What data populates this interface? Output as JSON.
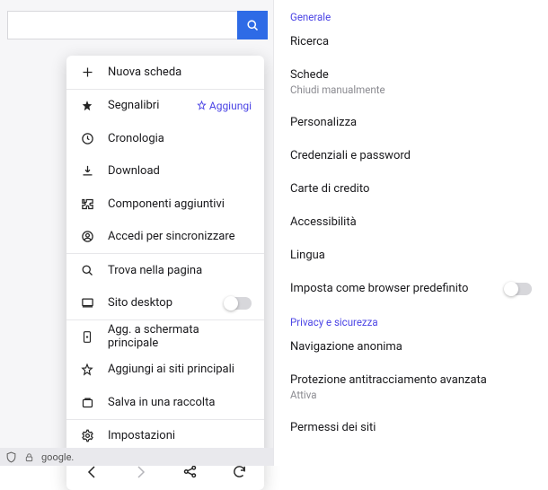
{
  "search": {
    "placeholder": ""
  },
  "menu": {
    "new_tab": "Nuova scheda",
    "bookmarks": "Segnalibri",
    "add_bookmark": "Aggiungi",
    "history": "Cronologia",
    "downloads": "Download",
    "addons": "Componenti aggiuntivi",
    "sync": "Accedi per sincronizzare",
    "find": "Trova nella pagina",
    "desktop_site": "Sito desktop",
    "add_home": "Agg. a schermata principale",
    "top_sites": "Aggiungi ai siti principali",
    "collection": "Salva in una raccolta",
    "settings": "Impostazioni"
  },
  "urlbar": {
    "host": "google."
  },
  "settings": {
    "sections": {
      "general": "Generale",
      "privacy": "Privacy e sicurezza"
    },
    "general": {
      "search": "Ricerca",
      "tabs": "Schede",
      "tabs_sub": "Chiudi manualmente",
      "customize": "Personalizza",
      "credentials": "Credenziali e password",
      "cards": "Carte di credito",
      "accessibility": "Accessibilità",
      "language": "Lingua",
      "default_browser": "Imposta come browser predefinito"
    },
    "privacy": {
      "private": "Navigazione anonima",
      "tracking": "Protezione antitracciamento avanzata",
      "tracking_sub": "Attiva",
      "site_perms": "Permessi dei siti"
    }
  }
}
